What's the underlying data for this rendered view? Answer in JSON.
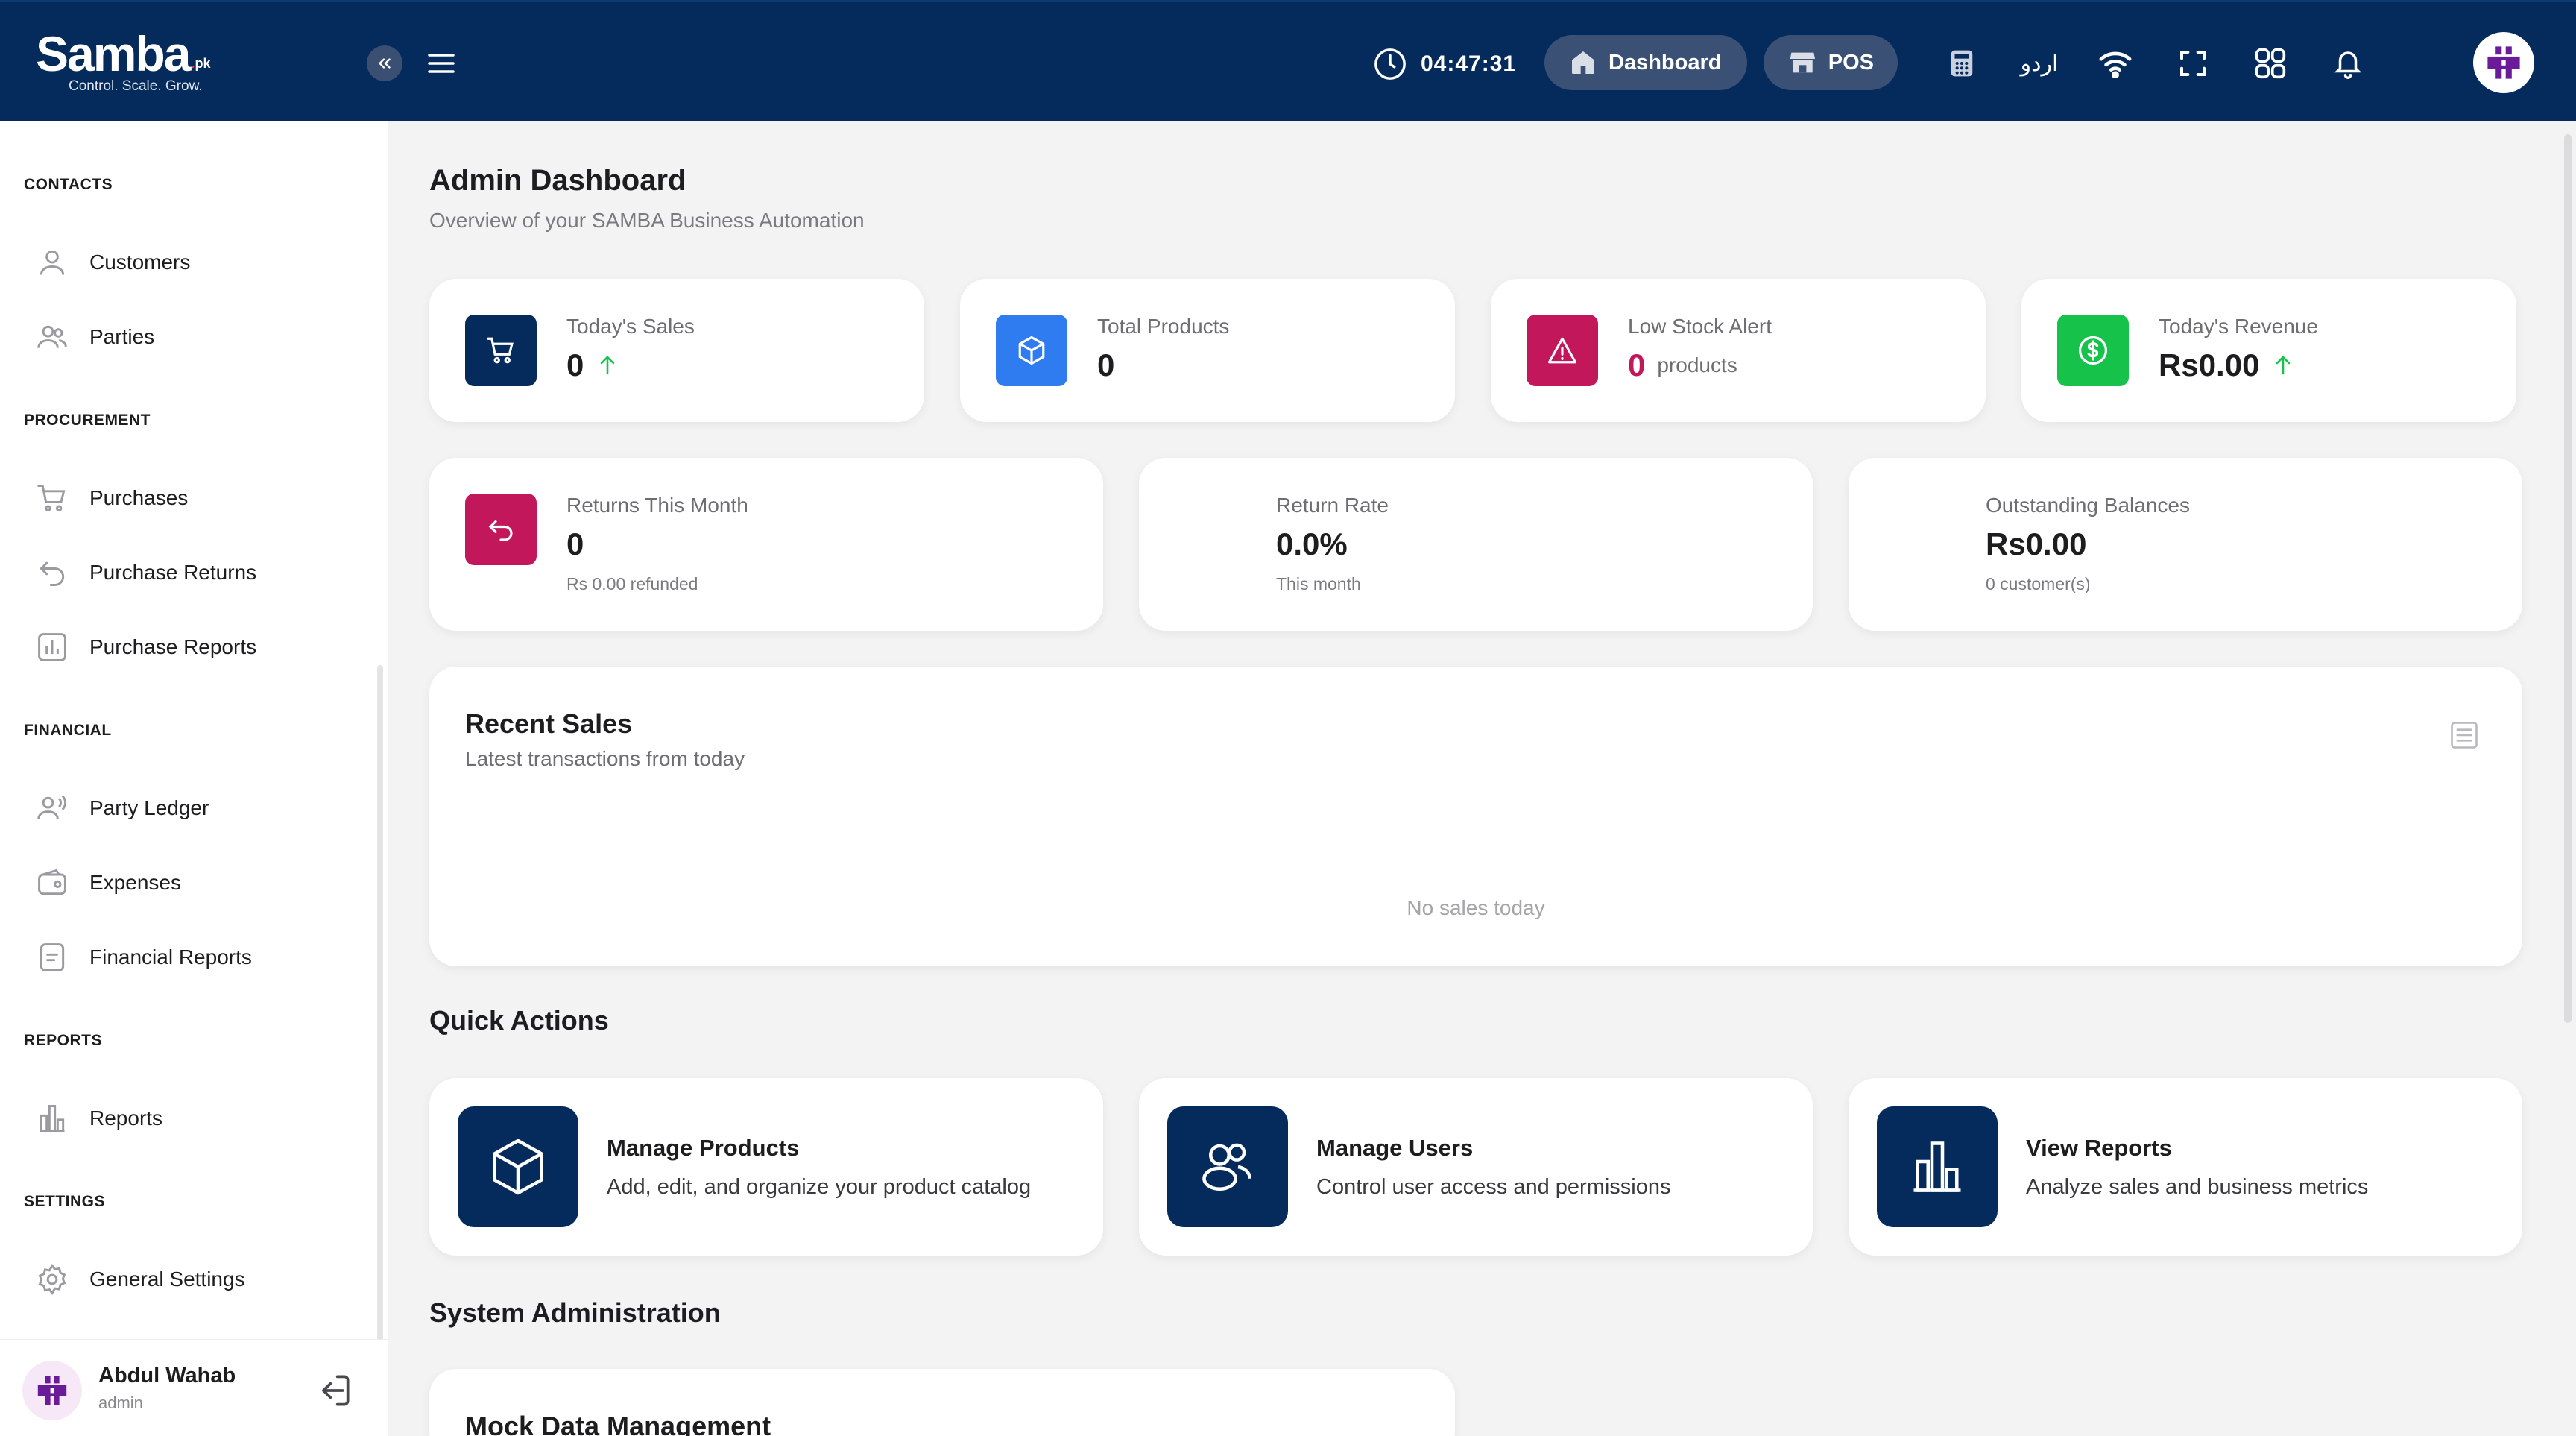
{
  "header": {
    "logo_text": "Samba",
    "logo_suffix": ".pk",
    "tagline": "Control. Scale. Grow.",
    "time": "04:47:31",
    "dashboard_label": "Dashboard",
    "pos_label": "POS",
    "language_label": "اردو",
    "icons": [
      "clock-icon",
      "calculator-icon",
      "wifi-icon",
      "fullscreen-icon",
      "apps-grid-icon",
      "bell-icon"
    ]
  },
  "sidebar": {
    "sections": [
      {
        "title": "CONTACTS",
        "items": [
          {
            "label": "Customers",
            "icon": "user-icon"
          },
          {
            "label": "Parties",
            "icon": "users-icon"
          }
        ]
      },
      {
        "title": "PROCUREMENT",
        "items": [
          {
            "label": "Purchases",
            "icon": "cart-icon"
          },
          {
            "label": "Purchase Returns",
            "icon": "return-icon"
          },
          {
            "label": "Purchase Reports",
            "icon": "bar-chart-icon"
          }
        ]
      },
      {
        "title": "FINANCIAL",
        "items": [
          {
            "label": "Party Ledger",
            "icon": "ledger-icon"
          },
          {
            "label": "Expenses",
            "icon": "wallet-icon"
          },
          {
            "label": "Financial Reports",
            "icon": "report-doc-icon"
          }
        ]
      },
      {
        "title": "REPORTS",
        "items": [
          {
            "label": "Reports",
            "icon": "bar-chart-icon"
          }
        ]
      },
      {
        "title": "SETTINGS",
        "items": [
          {
            "label": "General Settings",
            "icon": "gear-icon"
          }
        ]
      }
    ],
    "user": {
      "name": "Abdul Wahab",
      "role": "admin"
    }
  },
  "page": {
    "title": "Admin Dashboard",
    "subtitle": "Overview of your SAMBA Business Automation"
  },
  "stats": [
    {
      "label": "Today's Sales",
      "value": "0",
      "color": "#052a5c"
    },
    {
      "label": "Total Products",
      "value": "0",
      "color": "#2f7cf0"
    },
    {
      "label": "Low Stock Alert",
      "value": "0",
      "unit": "products",
      "color": "#c2185b"
    },
    {
      "label": "Today's Revenue",
      "value": "Rs0.00",
      "color": "#17c24b"
    }
  ],
  "stats2": [
    {
      "label": "Returns This Month",
      "value": "0",
      "note": "Rs 0.00 refunded",
      "color": "#c2185b"
    },
    {
      "label": "Return Rate",
      "value": "0.0%",
      "note": "This month"
    },
    {
      "label": "Outstanding Balances",
      "value": "Rs0.00",
      "note": "0 customer(s)"
    }
  ],
  "recent_sales": {
    "title": "Recent Sales",
    "subtitle": "Latest transactions from today",
    "empty_text": "No sales today"
  },
  "quick_actions": {
    "title": "Quick Actions",
    "items": [
      {
        "title": "Manage Products",
        "desc": "Add, edit, and organize your product catalog",
        "icon": "box-icon"
      },
      {
        "title": "Manage Users",
        "desc": "Control user access and permissions",
        "icon": "users-icon"
      },
      {
        "title": "View Reports",
        "desc": "Analyze sales and business metrics",
        "icon": "bar-chart-icon"
      }
    ]
  },
  "system_admin": {
    "title": "System Administration",
    "mock_title": "Mock Data Management"
  },
  "colors": {
    "brand": "#052a5c",
    "accent_green": "#17c24b",
    "accent_pink": "#c2185b",
    "accent_blue": "#2f7cf0"
  }
}
